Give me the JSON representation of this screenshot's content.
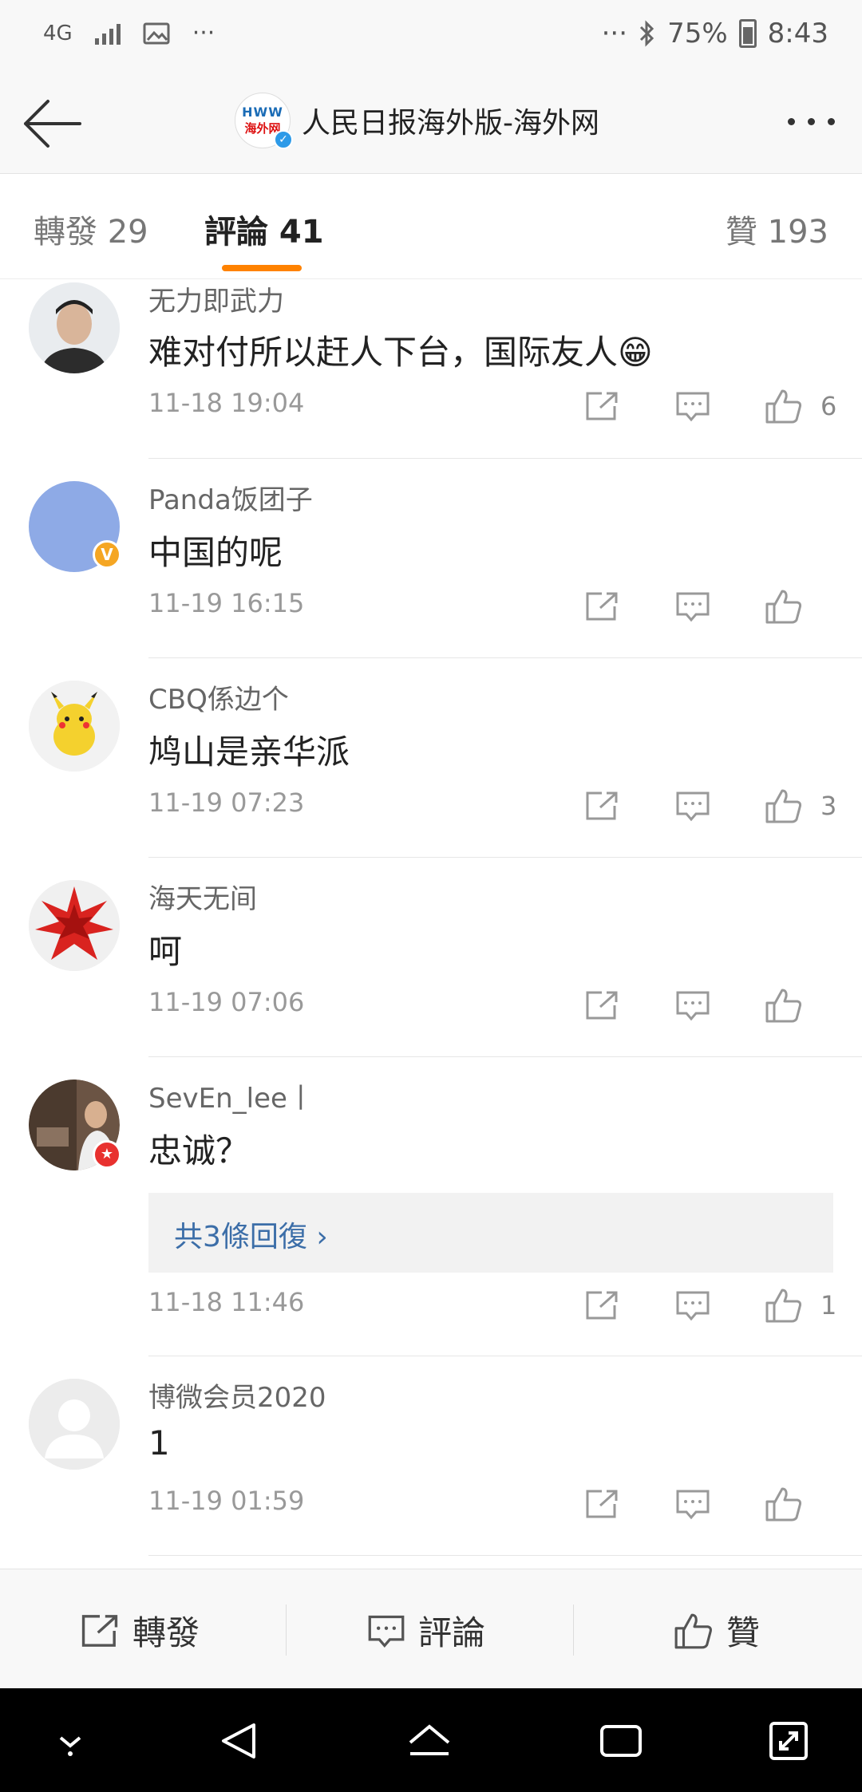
{
  "status_bar": {
    "network": "4G",
    "battery": "75%",
    "time": "8:43",
    "left_more": "···",
    "right_more": "···"
  },
  "header": {
    "title": "人民日报海外版-海外网",
    "logo_text_top": "HWW",
    "logo_text_bottom": "海外网"
  },
  "tabs": {
    "repost": "轉發 29",
    "comments": "評論 41",
    "likes": "贊 193"
  },
  "comments": [
    {
      "user": "无力即武力",
      "text": "难对付所以赶人下台，国际友人😁",
      "time": "11-18 19:04",
      "likes": "6"
    },
    {
      "user": "Panda饭团子",
      "text": "中国的呢",
      "time": "11-19 16:15",
      "likes": ""
    },
    {
      "user": "CBQ係边个",
      "text": "鸠山是亲华派",
      "time": "11-19 07:23",
      "likes": "3"
    },
    {
      "user": "海天无间",
      "text": "呵",
      "time": "11-19 07:06",
      "likes": ""
    },
    {
      "user": "SevEn_lee丨",
      "text": "忠诚？",
      "time": "11-18 11:46",
      "likes": "1",
      "replies": "共3條回復 ›"
    },
    {
      "user": "博微会员2020",
      "text": "1",
      "time": "11-19 01:59",
      "likes": ""
    }
  ],
  "bottom_bar": {
    "repost": "轉發",
    "comment": "評論",
    "like": "贊"
  },
  "colors": {
    "accent": "#ff8200",
    "link": "#3c6ea8",
    "verified_yellow": "#f5a623",
    "verified_red": "#e8312f"
  }
}
